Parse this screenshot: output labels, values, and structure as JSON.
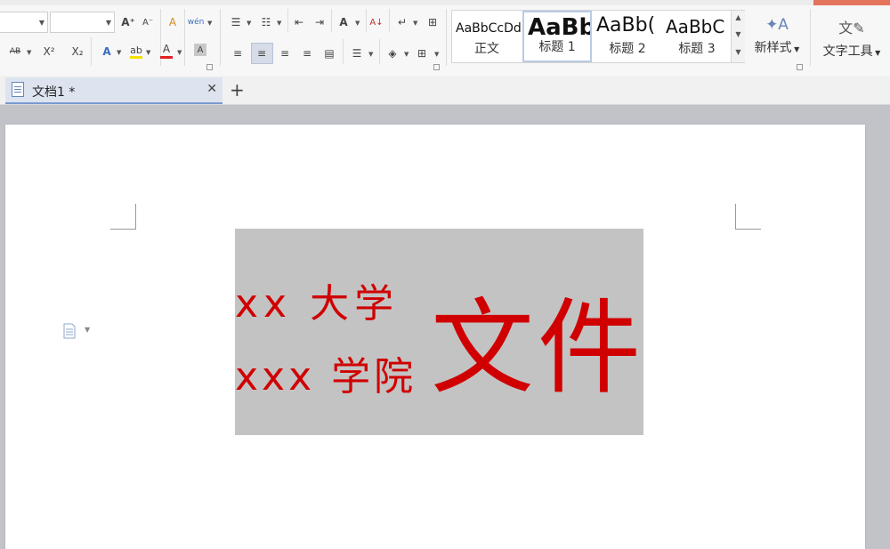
{
  "toolbar": {
    "buttons": {
      "grow_font": "A⁺",
      "shrink_font": "A⁻",
      "clear_format": "A",
      "phonetic": "wén",
      "superscript": "X²",
      "subscript": "X₂",
      "text_effect": "A",
      "highlight": "ab",
      "font_color": "A",
      "char_shading": "A",
      "strikethrough": "AB",
      "sort": "A↓",
      "bullets": "☰",
      "numbering": "☷",
      "indent_dec": "⇤",
      "indent_inc": "⇥",
      "spacing": "A",
      "show_marks": "↵",
      "table": "⊞",
      "align_left": "≡",
      "align_center": "≡",
      "align_right": "≡",
      "justify": "≡",
      "distribute": "▤",
      "line_spacing": "☰",
      "fill": "◈",
      "border": "⊞"
    },
    "styles": [
      {
        "sample": "AaBbCcDd",
        "name": "正文"
      },
      {
        "sample": "AaBb",
        "name": "标题 1"
      },
      {
        "sample": "AaBb(",
        "name": "标题 2"
      },
      {
        "sample": "AaBbC",
        "name": "标题 3"
      }
    ],
    "new_style_label": "新样式",
    "text_tools_label": "文字工具",
    "colors": {
      "font_color_bar": "#e02020",
      "highlight_bar": "#f5e000"
    }
  },
  "tabs": [
    {
      "label": "文档1 *"
    }
  ],
  "document": {
    "header": {
      "line1": "xx 大学",
      "line2": "xxx 学院",
      "big": "文件"
    },
    "colors": {
      "red": "#d00000",
      "box_bg": "#c3c3c3"
    }
  }
}
